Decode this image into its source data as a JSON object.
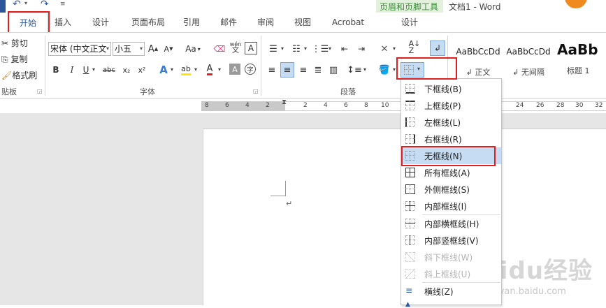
{
  "window": {
    "title": "文档1 - Word",
    "contextual_group": "页眉和页脚工具"
  },
  "tabs": [
    {
      "label": "开始"
    },
    {
      "label": "插入"
    },
    {
      "label": "设计"
    },
    {
      "label": "页面布局"
    },
    {
      "label": "引用"
    },
    {
      "label": "邮件"
    },
    {
      "label": "审阅"
    },
    {
      "label": "视图"
    },
    {
      "label": "Acrobat"
    },
    {
      "label": "设计"
    }
  ],
  "clipboard": {
    "cut": "剪切",
    "copy": "复制",
    "format_painter": "格式刷",
    "group_label": "贴板"
  },
  "font": {
    "family_value": "宋体 (中文正文",
    "size_value": "小五",
    "group_label": "字体",
    "change_case": "Aa",
    "phonetic_top": "wén",
    "phonetic_bottom": "文",
    "border_char": "A",
    "bold": "B",
    "italic": "I",
    "underline": "U",
    "strike": "abc",
    "subscript": "x₂",
    "superscript": "x²",
    "text_effect": "A",
    "font_color": "A",
    "char_shading": "A",
    "enclose": "字",
    "grow": "A",
    "shrink": "A",
    "clear": "A"
  },
  "paragraph": {
    "group_label": "段落"
  },
  "styles": [
    {
      "preview": "AaBbCcDd",
      "name": "↲ 正文"
    },
    {
      "preview": "AaBbCcDd",
      "name": "↲ 无间隔"
    },
    {
      "preview": "AaBb",
      "name": "标题 1"
    }
  ],
  "ruler": {
    "left_ticks": [
      "8",
      "6",
      "4",
      "2"
    ],
    "right_ticks": [
      "2",
      "4",
      "6",
      "8",
      "10"
    ],
    "far_ticks": [
      "24",
      "26",
      "28",
      "30",
      "32"
    ]
  },
  "document": {
    "paragraph_mark": "↵"
  },
  "border_menu": {
    "items": [
      {
        "label": "下框线(B)",
        "disabled": false
      },
      {
        "label": "上框线(P)",
        "disabled": false
      },
      {
        "label": "左框线(L)",
        "disabled": false
      },
      {
        "label": "右框线(R)",
        "disabled": false
      },
      {
        "label": "无框线(N)",
        "disabled": false,
        "highlighted": true
      },
      {
        "label": "所有框线(A)",
        "disabled": false
      },
      {
        "label": "外侧框线(S)",
        "disabled": false
      },
      {
        "label": "内部框线(I)",
        "disabled": false
      },
      {
        "label": "内部横框线(H)",
        "disabled": false
      },
      {
        "label": "内部竖框线(V)",
        "disabled": false
      },
      {
        "label": "斜下框线(W)",
        "disabled": true
      },
      {
        "label": "斜上框线(U)",
        "disabled": true
      },
      {
        "label": "横线(Z)",
        "disabled": false
      }
    ]
  },
  "watermark": {
    "brand": "Baidu经验",
    "url": "jingyan.baidu.com"
  },
  "colors": {
    "accent_blue": "#2b579a",
    "highlight_red": "#e02020",
    "hover_blue": "#c5dcf3",
    "context_green": "#e3f1dc"
  }
}
